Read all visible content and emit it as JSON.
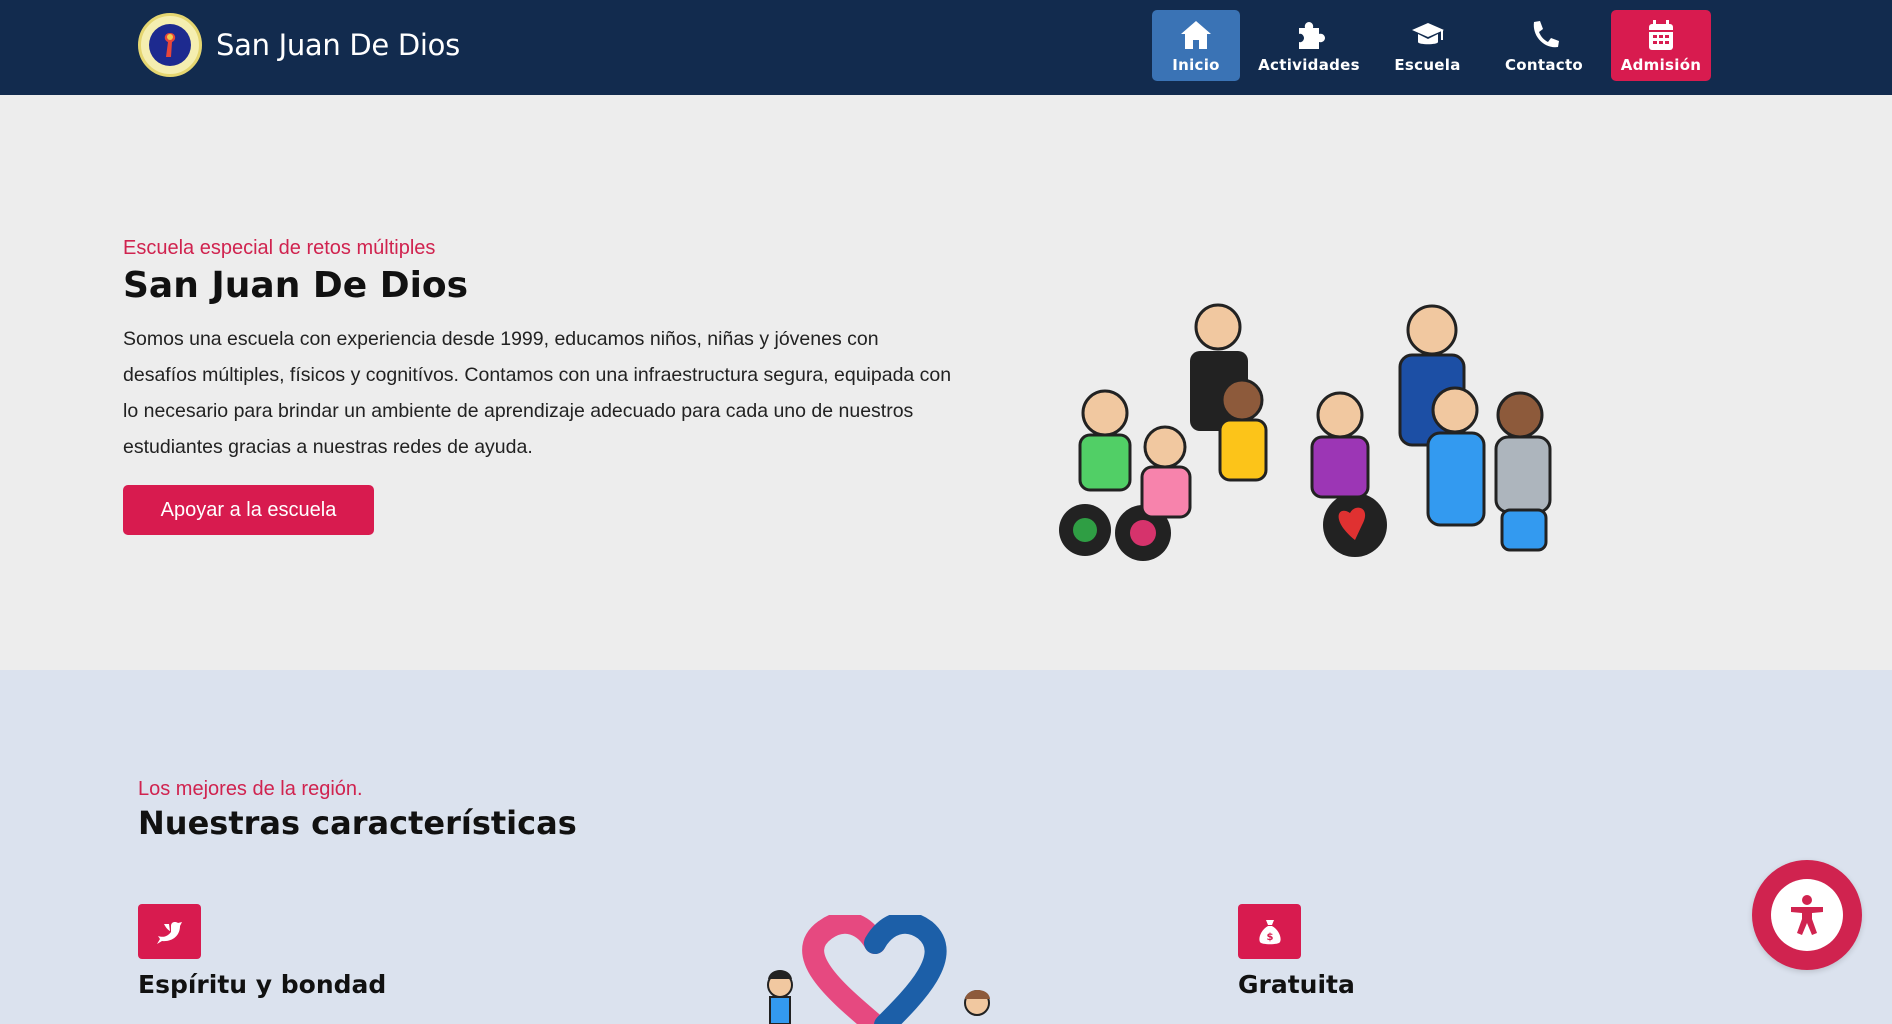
{
  "header": {
    "brand": "San Juan De Dios",
    "nav": [
      {
        "label": "Inicio",
        "icon": "home-icon"
      },
      {
        "label": "Actividades",
        "icon": "puzzle-icon"
      },
      {
        "label": "Escuela",
        "icon": "graduation-cap-icon"
      },
      {
        "label": "Contacto",
        "icon": "phone-icon"
      },
      {
        "label": "Admisión",
        "icon": "calendar-icon"
      }
    ],
    "colors": {
      "bar": "#122b4e",
      "active": "#3a73b5",
      "cta": "#d81b4f"
    }
  },
  "hero": {
    "eyebrow": "Escuela especial de retos múltiples",
    "title": "San Juan De Dios",
    "description": "Somos una escuela con experiencia desde 1999, educamos niños, niñas y jóvenes con desafíos múltiples, físicos y cognitívos. Contamos con una infraestructura segura, equipada con lo necesario para brindar un ambiente de aprendizaje adecuado para cada uno de nuestros estudiantes gracias a nuestras redes de ayuda.",
    "button": "Apoyar a la escuela",
    "illustration": "children-group-illustration"
  },
  "features": {
    "eyebrow": "Los mejores de la región.",
    "title": "Nuestras características",
    "items": [
      {
        "name": "Espíritu y bondad",
        "icon": "dove-icon"
      },
      {
        "name": "Gratuita",
        "icon": "money-bag-icon"
      }
    ],
    "illustration": "heart-illustration"
  },
  "accessibility": {
    "icon": "accessibility-icon"
  },
  "accent": "#d0234f"
}
